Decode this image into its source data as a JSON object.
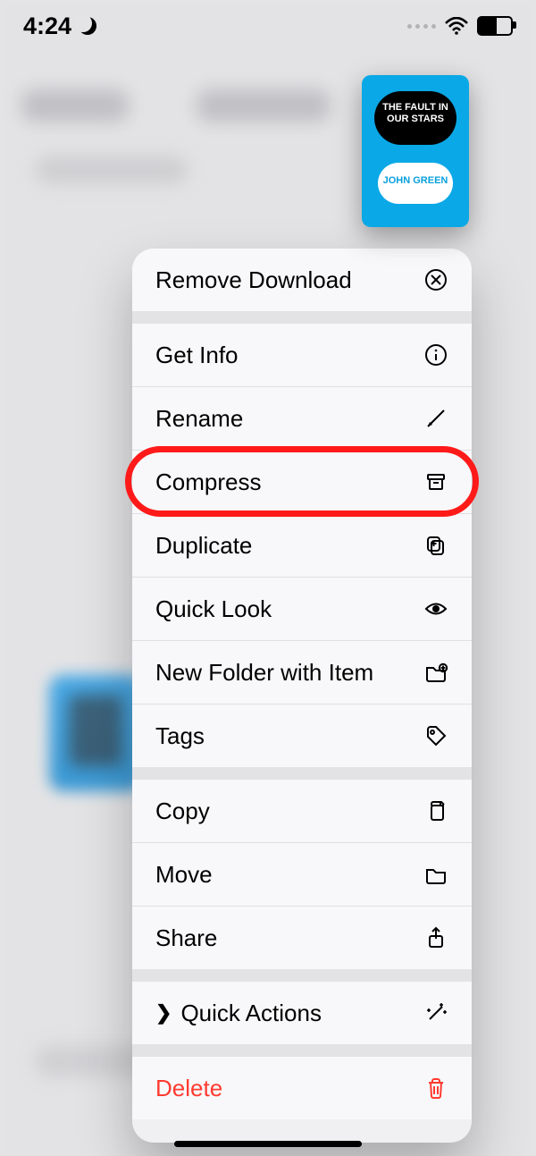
{
  "status": {
    "time": "4:24",
    "battery_pct": 55
  },
  "file": {
    "cover_title": "THE FAULT IN OUR STARS",
    "cover_author": "JOHN GREEN"
  },
  "menu": {
    "groups": [
      {
        "items": [
          {
            "key": "remove",
            "label": "Remove Download",
            "icon": "x-circle"
          }
        ]
      },
      {
        "items": [
          {
            "key": "info",
            "label": "Get Info",
            "icon": "info"
          },
          {
            "key": "rename",
            "label": "Rename",
            "icon": "pencil"
          },
          {
            "key": "compress",
            "label": "Compress",
            "icon": "archive",
            "highlighted": true
          },
          {
            "key": "duplicate",
            "label": "Duplicate",
            "icon": "dup"
          },
          {
            "key": "quicklook",
            "label": "Quick Look",
            "icon": "eye"
          },
          {
            "key": "newfolder",
            "label": "New Folder with Item",
            "icon": "folder-plus"
          },
          {
            "key": "tags",
            "label": "Tags",
            "icon": "tag"
          }
        ]
      },
      {
        "items": [
          {
            "key": "copy",
            "label": "Copy",
            "icon": "docs"
          },
          {
            "key": "move",
            "label": "Move",
            "icon": "folder"
          },
          {
            "key": "share",
            "label": "Share",
            "icon": "share"
          }
        ]
      },
      {
        "items": [
          {
            "key": "quickactions",
            "label": "Quick Actions",
            "icon": "wand",
            "chevron": true
          }
        ]
      },
      {
        "items": [
          {
            "key": "delete",
            "label": "Delete",
            "icon": "trash",
            "danger": true
          }
        ]
      }
    ]
  },
  "colors": {
    "danger": "#ff3b30",
    "highlight": "#ff1a1a",
    "cover": "#0aa8e6"
  }
}
